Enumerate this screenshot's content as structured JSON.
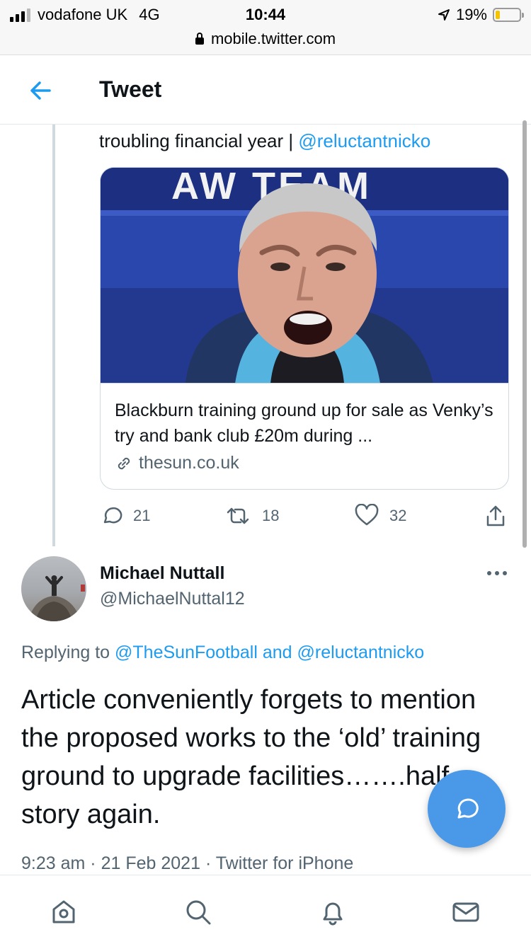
{
  "status_bar": {
    "carrier": "vodafone UK",
    "network": "4G",
    "time": "10:44",
    "battery_percent": "19%",
    "battery_level": 0.19,
    "url": "mobile.twitter.com"
  },
  "header": {
    "title": "Tweet",
    "back_icon": "arrow-left-icon"
  },
  "previous_tweet": {
    "text_line": "troubling financial year |",
    "mention": "@reluctantnicko",
    "card": {
      "image_text": "AW  TEAM",
      "title": "Blackburn training ground up for sale as Venky’s try and bank club £20m during ...",
      "domain": "thesun.co.uk",
      "domain_icon": "link-icon"
    },
    "actions": {
      "reply_count": "21",
      "retweet_count": "18",
      "like_count": "32"
    }
  },
  "tweet": {
    "author_name": "Michael Nuttall",
    "author_handle": "@MichaelNuttal12",
    "replying_prefix": "Replying to",
    "replying_to_1": "@TheSunFootball",
    "replying_and": "and",
    "replying_to_2": "@reluctantnicko",
    "text": "Article conveniently forgets to mention the proposed works to the ‘old’ training ground to upgrade facilities…….half a story again.",
    "time": "9:23 am",
    "date": "21 Feb 2021",
    "source": "Twitter for iPhone",
    "separator": "·"
  },
  "bottom_nav": {
    "items": [
      "home-icon",
      "search-icon",
      "notifications-icon",
      "messages-icon"
    ]
  },
  "colors": {
    "accent": "#1d9bf0",
    "fab": "#4a99e9",
    "secondary_text": "#536471",
    "battery": "#f5c400"
  }
}
